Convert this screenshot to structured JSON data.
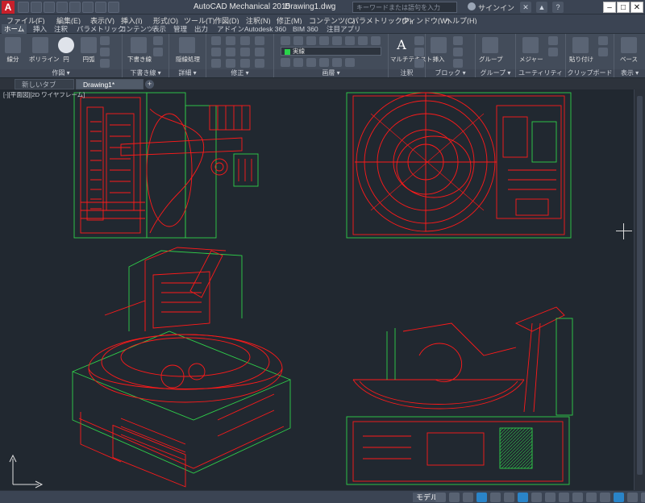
{
  "app": {
    "logo_text": "A",
    "title": "AutoCAD Mechanical 2015",
    "document": "Drawing1.dwg",
    "search_placeholder": "キーワードまたは語句を入力",
    "signin": "サインイン"
  },
  "window_controls": {
    "minimize": "–",
    "maximize": "□",
    "close": "✕"
  },
  "menu": [
    "ファイル(F)",
    "編集(E)",
    "表示(V)",
    "挿入(I)",
    "形式(O)",
    "ツール(T)",
    "作図(D)",
    "注釈(N)",
    "修正(M)",
    "コンテンツ(C)",
    "パラメトリック(P)",
    "ウィンドウ(W)",
    "ヘルプ(H)"
  ],
  "ribbon_tabs": [
    "ホーム",
    "挿入",
    "注釈",
    "パラメトリック",
    "コンテンツ",
    "表示",
    "管理",
    "出力",
    "アドイン",
    "Autodesk 360",
    "BIM 360",
    "注目アプリ"
  ],
  "ribbon": {
    "draw": {
      "title": "作図 ▾",
      "buttons": [
        "線分",
        "ポリライン",
        "円",
        "円弧"
      ]
    },
    "construction": {
      "title": "下書き線 ▾",
      "button": "下書き線"
    },
    "detail": {
      "title": "詳細 ▾",
      "button": "隠線処理"
    },
    "modify": {
      "title": "修正 ▾"
    },
    "layer": {
      "title": "画層 ▾",
      "current": "実線"
    },
    "annotation": {
      "title": "注釈",
      "button": "マルチテキスト"
    },
    "block": {
      "title": "ブロック ▾",
      "button": "挿入"
    },
    "group": {
      "title": "グループ ▾",
      "button": "グループ"
    },
    "utility": {
      "title": "ユーティリティ ▾",
      "button": "メジャー"
    },
    "clipboard": {
      "title": "クリップボード",
      "button": "貼り付け"
    },
    "view": {
      "title": "表示 ▾",
      "button": "ベース"
    }
  },
  "file_tabs": {
    "new_tab": "新しいタブ",
    "drawing": "Drawing1*",
    "add": "+"
  },
  "viewport": {
    "label": "[-][平面図][2D ワイヤフレーム]"
  },
  "statusbar": {
    "model": "モデル"
  },
  "colors": {
    "geometry": "#ff1a1a",
    "edge": "#2fd04a",
    "background": "#212830"
  }
}
